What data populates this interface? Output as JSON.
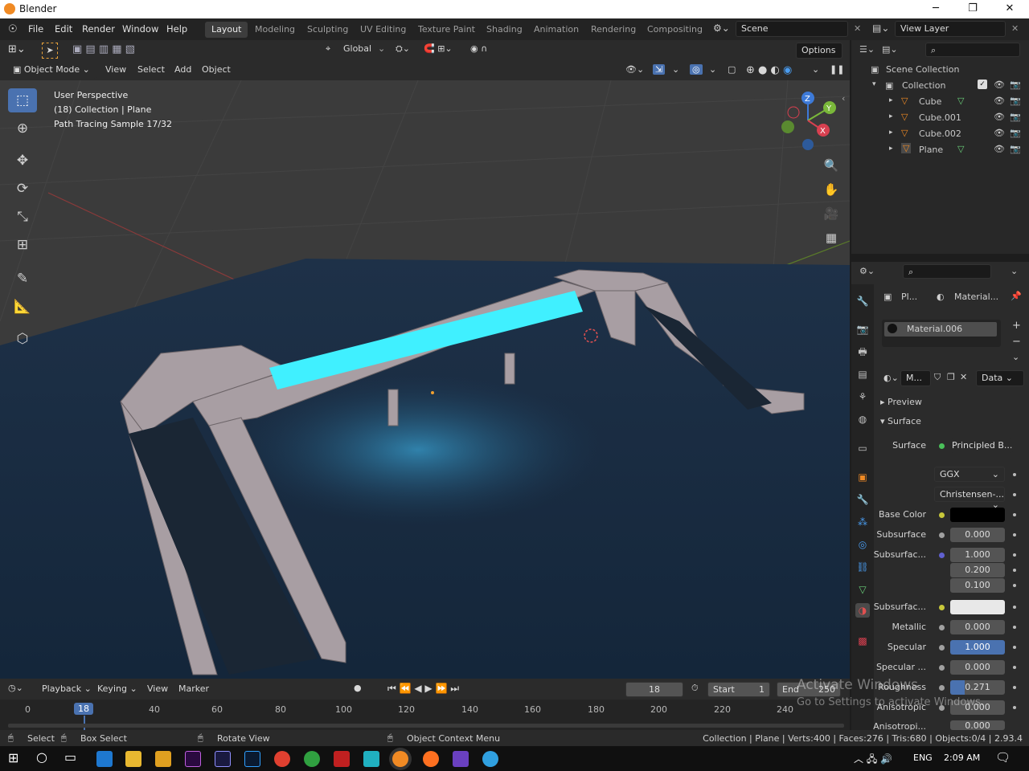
{
  "window": {
    "title": "Blender",
    "minimize": "─",
    "maximize": "❐",
    "close": "✕"
  },
  "menu": [
    "File",
    "Edit",
    "Render",
    "Window",
    "Help"
  ],
  "workspaces": [
    "Layout",
    "Modeling",
    "Sculpting",
    "UV Editing",
    "Texture Paint",
    "Shading",
    "Animation",
    "Rendering",
    "Compositing"
  ],
  "scene": "Scene",
  "view_layer": "View Layer",
  "toolbar": {
    "transform_orientation": "Global",
    "options": "Options"
  },
  "viewport_header": {
    "mode": "Object Mode",
    "menus": [
      "View",
      "Select",
      "Add",
      "Object"
    ]
  },
  "overlay_text": {
    "line1": "User Perspective",
    "line2": "(18) Collection | Plane",
    "line3": "Path Tracing Sample 17/32"
  },
  "gizmo": {
    "z": "Z",
    "y": "Y",
    "x": "X"
  },
  "outliner": {
    "scene_collection": "Scene Collection",
    "collection": "Collection",
    "items": [
      "Cube",
      "Cube.001",
      "Cube.002",
      "Plane"
    ]
  },
  "properties": {
    "object_short": "Pl...",
    "material_short": "Material...",
    "material_slot": "Material.006",
    "material_name_short": "M...",
    "data_dropdown": "Data",
    "panel_preview": "Preview",
    "panel_surface": "Surface",
    "surface_label": "Surface",
    "surface_value": "Principled B...",
    "distribution": "GGX",
    "subsurface_method": "Christensen-...",
    "rows": [
      {
        "label": "Base Color",
        "kind": "color",
        "color": "#000000"
      },
      {
        "label": "Subsurface",
        "value": "0.000"
      },
      {
        "label": "Subsurfac...",
        "values": [
          "1.000",
          "0.200",
          "0.100"
        ]
      },
      {
        "label": "Subsurfac...",
        "kind": "color",
        "color": "#e8e8e8"
      },
      {
        "label": "Metallic",
        "value": "0.000"
      },
      {
        "label": "Specular",
        "value": "1.000",
        "fill": 1.0
      },
      {
        "label": "Specular ...",
        "value": "0.000"
      },
      {
        "label": "Roughness",
        "value": "0.271",
        "fill": 0.271
      },
      {
        "label": "Anisotropic",
        "value": "0.000"
      },
      {
        "label": "Anisotropi...",
        "value": "0.000"
      }
    ]
  },
  "timeline": {
    "menus": [
      "Playback",
      "Keying",
      "View",
      "Marker"
    ],
    "current_frame": "18",
    "start_label": "Start",
    "start": "1",
    "end_label": "End",
    "end": "250",
    "ticks": [
      "0",
      "18",
      "40",
      "60",
      "80",
      "100",
      "120",
      "140",
      "160",
      "180",
      "200",
      "220",
      "240"
    ]
  },
  "statusbar": {
    "select": "Select",
    "box_select": "Box Select",
    "rotate": "Rotate View",
    "context_menu": "Object Context Menu",
    "stats": "Collection | Plane | Verts:400 | Faces:276 | Tris:680 | Objects:0/4 | 2.93.4"
  },
  "watermark": {
    "line1": "Activate Windows",
    "line2": "Go to Settings to activate Windows."
  },
  "taskbar": {
    "language": "ENG",
    "time": "2:09 AM"
  },
  "colors": {
    "accent_blue": "#4a72b0",
    "glow_cyan": "#40f0ff",
    "orange": "#f08a24"
  }
}
